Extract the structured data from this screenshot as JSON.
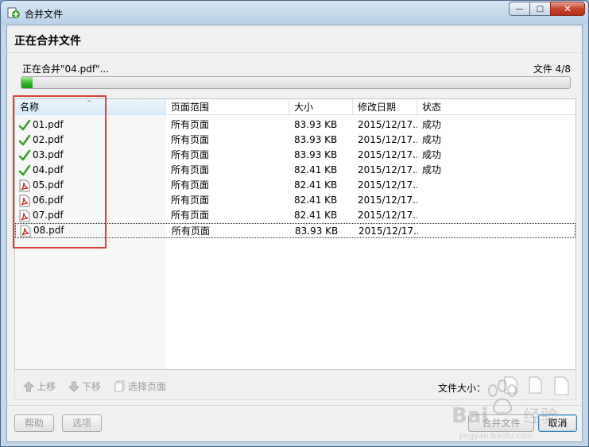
{
  "window": {
    "title": "合并文件",
    "min_label": "—",
    "max_label": "□",
    "close_label": "✕"
  },
  "heading": "正在合并文件",
  "progress": {
    "label": "正在合并\"04.pdf\"...",
    "count": "文件 4/8",
    "fraction": 0.02
  },
  "columns": {
    "name": "名称",
    "range": "页面范围",
    "size": "大小",
    "date": "修改日期",
    "state": "状态"
  },
  "files": [
    {
      "name": "01.pdf",
      "range": "所有页面",
      "size": "83.93 KB",
      "date": "2015/12/17...",
      "state": "成功",
      "icon": "check-icon"
    },
    {
      "name": "02.pdf",
      "range": "所有页面",
      "size": "83.93 KB",
      "date": "2015/12/17...",
      "state": "成功",
      "icon": "check-icon"
    },
    {
      "name": "03.pdf",
      "range": "所有页面",
      "size": "83.93 KB",
      "date": "2015/12/17...",
      "state": "成功",
      "icon": "check-icon"
    },
    {
      "name": "04.pdf",
      "range": "所有页面",
      "size": "82.41 KB",
      "date": "2015/12/17...",
      "state": "成功",
      "icon": "check-icon"
    },
    {
      "name": "05.pdf",
      "range": "所有页面",
      "size": "82.41 KB",
      "date": "2015/12/17...",
      "state": "",
      "icon": "pdf-icon"
    },
    {
      "name": "06.pdf",
      "range": "所有页面",
      "size": "82.41 KB",
      "date": "2015/12/17...",
      "state": "",
      "icon": "pdf-icon"
    },
    {
      "name": "07.pdf",
      "range": "所有页面",
      "size": "82.41 KB",
      "date": "2015/12/17...",
      "state": "",
      "icon": "pdf-icon"
    },
    {
      "name": "08.pdf",
      "range": "所有页面",
      "size": "83.93 KB",
      "date": "2015/12/17...",
      "state": "",
      "icon": "pdf-icon"
    }
  ],
  "toolbar": {
    "move_up": "上移",
    "move_down": "下移",
    "select_pages": "选择页面",
    "file_size_label": "文件大小："
  },
  "buttons": {
    "help": "帮助",
    "options": "选项",
    "merge": "合并文件",
    "cancel": "取消"
  },
  "colors": {
    "progress_green": "#2fb526",
    "highlight_red": "#d9413a",
    "pdf_red": "#c8261d",
    "check_green": "#3aa12b"
  }
}
